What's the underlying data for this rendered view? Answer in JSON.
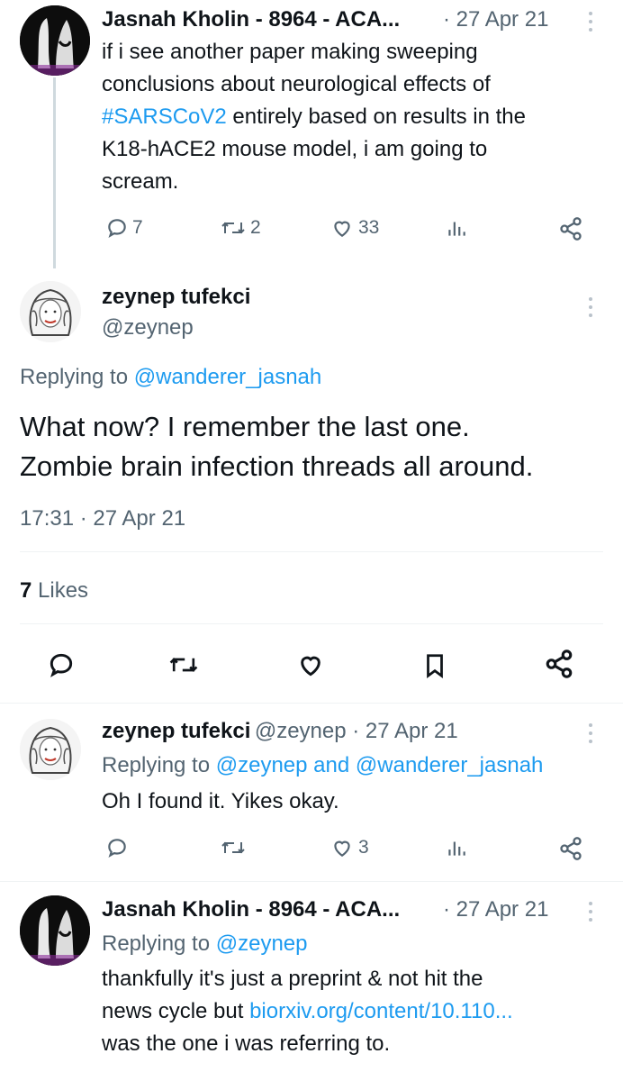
{
  "tweet1": {
    "author": "Jasnah Kholin - 8964 - ACA...",
    "date": "· 27 Apr 21",
    "lines": [
      {
        "pre": "if i see another paper making sweeping",
        "tag": "",
        "post": ""
      },
      {
        "pre": "conclusions about neurological effects of",
        "tag": "",
        "post": ""
      },
      {
        "pre": "",
        "tag": "#SARSCoV2",
        "post": " entirely based on results in the"
      },
      {
        "pre": "K18-hACE2 mouse model, i am going to",
        "tag": "",
        "post": ""
      },
      {
        "pre": "scream.",
        "tag": "",
        "post": ""
      }
    ],
    "replies": "7",
    "retweets": "2",
    "likes": "33"
  },
  "main": {
    "name": "zeynep tufekci",
    "handle": "@zeynep",
    "replying_prefix": "Replying to ",
    "replying_to": "@wanderer_jasnah",
    "text_line1": "What now? I remember the last one.",
    "text_line2": "Zombie brain infection threads all around.",
    "timestamp": "17:31 · 27 Apr 21",
    "likes_count": "7",
    "likes_label": " Likes"
  },
  "reply1": {
    "name": "zeynep tufekci",
    "handle_date": "@zeynep · 27 Apr 21",
    "replying_prefix": "Replying to ",
    "replying_to1": "@zeynep",
    "replying_and": " and ",
    "replying_to2": "@wanderer_jasnah",
    "text": "Oh I found it. Yikes okay.",
    "likes": "3"
  },
  "reply2": {
    "author": "Jasnah Kholin - 8964 - ACA...",
    "date": "· 27 Apr 21",
    "replying_prefix": "Replying to ",
    "replying_to": "@zeynep",
    "line1": "thankfully it's just a preprint & not hit the",
    "line2_pre": "news cycle but ",
    "line2_link": "biorxiv.org/content/10.110...",
    "line3": "was the one i was referring to."
  },
  "colors": {
    "link": "#1d9bf0",
    "muted": "#536471",
    "text": "#0f1419",
    "divider": "#eff3f4"
  }
}
